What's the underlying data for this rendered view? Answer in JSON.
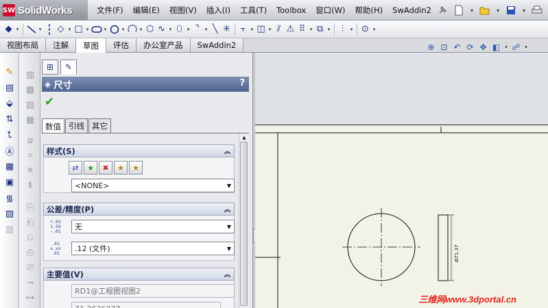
{
  "app": {
    "logo_mark": "SW",
    "title": "SolidWorks"
  },
  "menu": {
    "items": [
      "文件(F)",
      "编辑(E)",
      "视图(V)",
      "插入(I)",
      "工具(T)",
      "Toolbox",
      "窗口(W)",
      "帮助(H)",
      "SwAddin2"
    ]
  },
  "command_tabs": [
    {
      "label": "视图布局",
      "active": false
    },
    {
      "label": "注解",
      "active": false
    },
    {
      "label": "草图",
      "active": true
    },
    {
      "label": "评估",
      "active": false
    },
    {
      "label": "办公室产品",
      "active": false
    },
    {
      "label": "SwAddin2",
      "active": false
    }
  ],
  "property_manager": {
    "title": "尺寸",
    "help": "?",
    "ok_icon": "✔",
    "tabs": [
      "数值",
      "引线",
      "其它"
    ],
    "active_tab": "数值",
    "groups": {
      "style": {
        "title": "样式(S)",
        "selected": "<NONE>"
      },
      "tolerance": {
        "title": "公差/精度(P)",
        "tol_icon_text": "+.01\n1.50\n-.01",
        "prec_icon_text": ".01\nx.xx\n.01",
        "tolerance_type": "无",
        "precision": ".12 (文件)"
      },
      "primary": {
        "title": "主要值(V)",
        "reference": "RD1@工程图视图2",
        "value_partial": "71.3636237"
      }
    }
  },
  "drawing": {
    "dimension_text": "Ø71.37"
  },
  "watermark": "三维网www.3dportal.cn",
  "colors": {
    "header_bar": "#5b6e9a",
    "ok_green": "#2a9a2a",
    "sheet": "#f3f2e6",
    "watermark": "#e0261e"
  }
}
